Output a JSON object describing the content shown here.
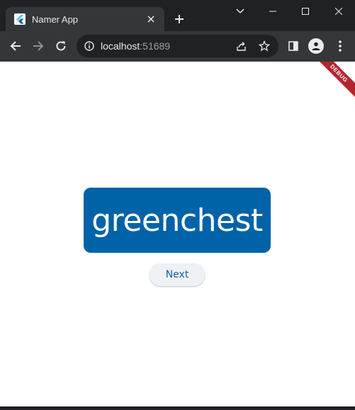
{
  "browser": {
    "tab": {
      "title": "Namer App",
      "favicon": "flutter-icon",
      "close_icon": "close-icon"
    },
    "new_tab_icon": "plus-icon",
    "window_controls": [
      "chevron-down-icon",
      "minimize-icon",
      "maximize-icon",
      "close-icon"
    ],
    "toolbar": {
      "back_icon": "back-arrow-icon",
      "forward_icon": "forward-arrow-icon",
      "reload_icon": "reload-icon",
      "site_info_icon": "info-icon",
      "url_host": "localhost",
      "url_port": ":51689",
      "share_icon": "share-icon",
      "bookmark_icon": "star-icon",
      "side_panel_icon": "side-panel-icon",
      "profile_icon": "avatar-icon",
      "menu_icon": "kebab-menu-icon"
    }
  },
  "app": {
    "word": "greenchest",
    "next_label": "Next",
    "debug_banner": "DEBUG"
  },
  "colors": {
    "card_background": "#0063a8",
    "card_text": "#ffffff",
    "button_text": "#145f9f",
    "debug_banner": "#b3262f"
  }
}
